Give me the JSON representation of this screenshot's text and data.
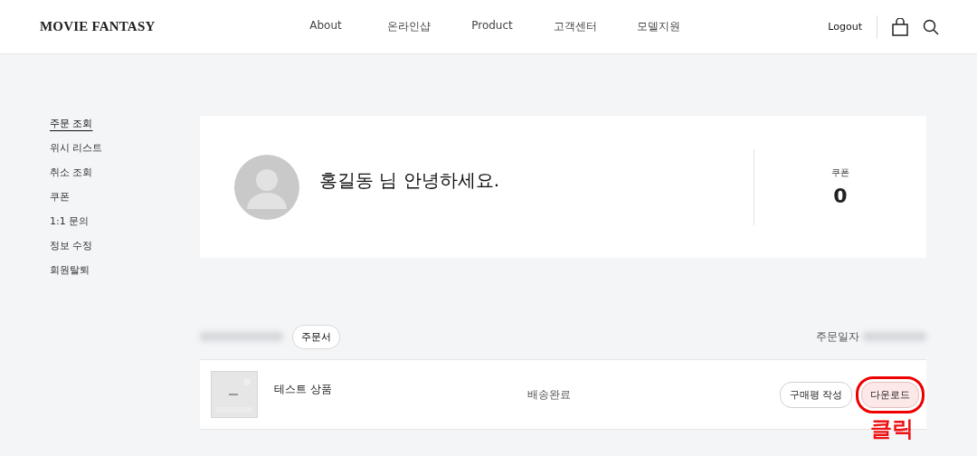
{
  "header": {
    "logo": "MOVIE FANTASY",
    "nav": [
      "About",
      "온라인샵",
      "Product",
      "고객센터",
      "모델지원"
    ],
    "logout": "Logout"
  },
  "sidebar": {
    "items": [
      {
        "label": "주문 조회",
        "selected": true
      },
      {
        "label": "위시 리스트",
        "selected": false
      },
      {
        "label": "취소 조회",
        "selected": false
      },
      {
        "label": "쿠폰",
        "selected": false
      },
      {
        "label": "1:1 문의",
        "selected": false
      },
      {
        "label": "정보 수정",
        "selected": false
      },
      {
        "label": "회원탈퇴",
        "selected": false
      }
    ]
  },
  "welcome": {
    "greeting": "홍길동 님 안녕하세요.",
    "coupon_label": "쿠폰",
    "coupon_count": "0"
  },
  "order": {
    "sheet_button": "주문서",
    "date_label": "주문일자",
    "items": [
      {
        "name": "테스트 상품",
        "status": "배송완료",
        "review_button": "구매평 작성",
        "download_button": "다운로드"
      }
    ]
  },
  "annotation": {
    "text": "클릭"
  }
}
